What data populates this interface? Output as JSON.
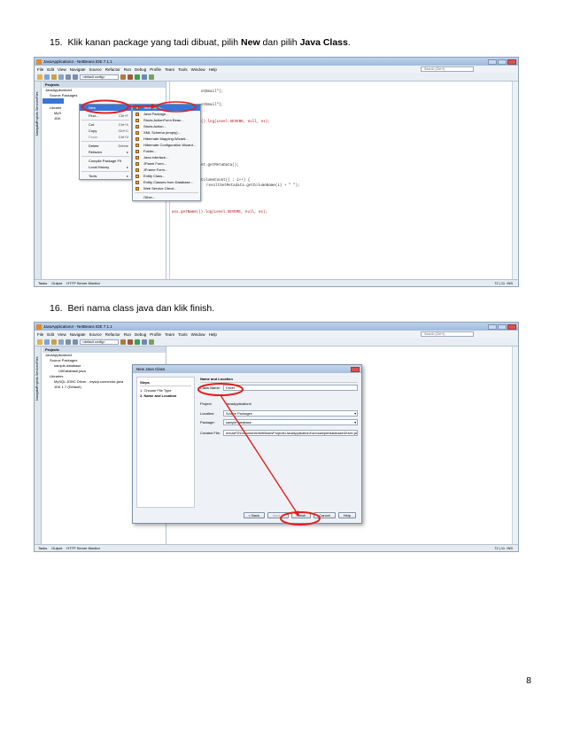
{
  "steps": {
    "s15": {
      "num": "15.",
      "pre": "Klik kanan package yang tadi dibuat, pilih ",
      "b1": "New",
      "mid": " dan pilih ",
      "b2": "Java Class",
      "post": "."
    },
    "s16": {
      "num": "16.",
      "text": "Beri nama class java dan klik finish."
    }
  },
  "page_number": "8",
  "ide": {
    "window_title": "JavaApplication4 - NetBeans IDE 7.1.1",
    "menus": [
      "File",
      "Edit",
      "View",
      "Navigate",
      "Source",
      "Refactor",
      "Run",
      "Debug",
      "Profile",
      "Team",
      "Tools",
      "Window",
      "Help"
    ],
    "search_placeholder": "Search (Ctrl+I)",
    "config": "<default config>",
    "side_tabs": [
      "Files",
      "Services",
      "Projects",
      "Navigator"
    ],
    "projects_title": "Projects",
    "status_tabs": [
      "Tasks",
      "Output",
      "HTTP Server Monitor"
    ],
    "caret_pos": "72 | 11",
    "ins": "INS"
  },
  "shot1": {
    "tree": [
      "JavaApplication4",
      "Source Packages",
      "Librarie",
      "MyS",
      "JDK"
    ],
    "context_menu": [
      {
        "label": "New",
        "shortcut": "",
        "sel": true
      },
      {
        "label": "Find...",
        "shortcut": "Ctrl+F"
      },
      {
        "label": "Cut",
        "shortcut": "Ctrl+X"
      },
      {
        "label": "Copy",
        "shortcut": "Ctrl+C"
      },
      {
        "label": "Paste",
        "shortcut": "Ctrl+V"
      },
      {
        "label": "Delete",
        "shortcut": "Delete"
      },
      {
        "label": "Refactor",
        "shortcut": ""
      },
      {
        "label": "Compile Package",
        "shortcut": "F9"
      },
      {
        "label": "Local History",
        "shortcut": ""
      },
      {
        "label": "Tools",
        "shortcut": ""
      }
    ],
    "new_submenu": [
      "Java Class...",
      "Java Package...",
      "Struts ActionForm Bean...",
      "Struts Action...",
      "XML Schema (empty)...",
      "Hibernate Mapping Wizard...",
      "Hibernate Configuration Wizard...",
      "Folder...",
      "Java Interface...",
      "JPanel Form...",
      "JFrame Form...",
      "Entity Class...",
      "Entity Classes from Database...",
      "Web Service Client...",
      "Other..."
    ],
    "code": [
      "etEmail\");",
      "etEmail\");",
      "().log(Level.SEVERE, null, ex);",
      "et.getMetaData();",
      "ColumnCount() ; i++) {",
      "resultSetMetadata.getColumnName(i) + \" \");",
      "ass.getName()).log(Level.SEVERE, null, ex);"
    ]
  },
  "shot2": {
    "tree": [
      "JavaApplication4",
      "Source Packages",
      "sample.database",
      "UIIDatabase.java",
      "Libraries",
      "MySQL JDBC Driver - mysql-connector-java",
      "JDK 1.7 (Default)"
    ],
    "dialog": {
      "title": "New Java Class",
      "steps_title": "Steps",
      "steps": [
        "1.  Choose File Type",
        "2.  Name and Location"
      ],
      "form_title": "Name and Location",
      "class_name_label": "Class Name:",
      "class_name": "Driver",
      "project_label": "Project:",
      "project": "JavaApplication4",
      "location_label": "Location:",
      "location": "Source Packages",
      "package_label": "Package:",
      "package": "sample.database",
      "created_label": "Created File:",
      "created": "ers\\asPZ\\Documents\\NetBeansProjects\\JavaApplication4\\src\\sample\\database\\Driver.java",
      "buttons": [
        "< Back",
        "Next >",
        "Finish",
        "Cancel",
        "Help"
      ]
    }
  },
  "colors": {
    "highlight": "#e02020",
    "menu_select": "#3875d7"
  }
}
